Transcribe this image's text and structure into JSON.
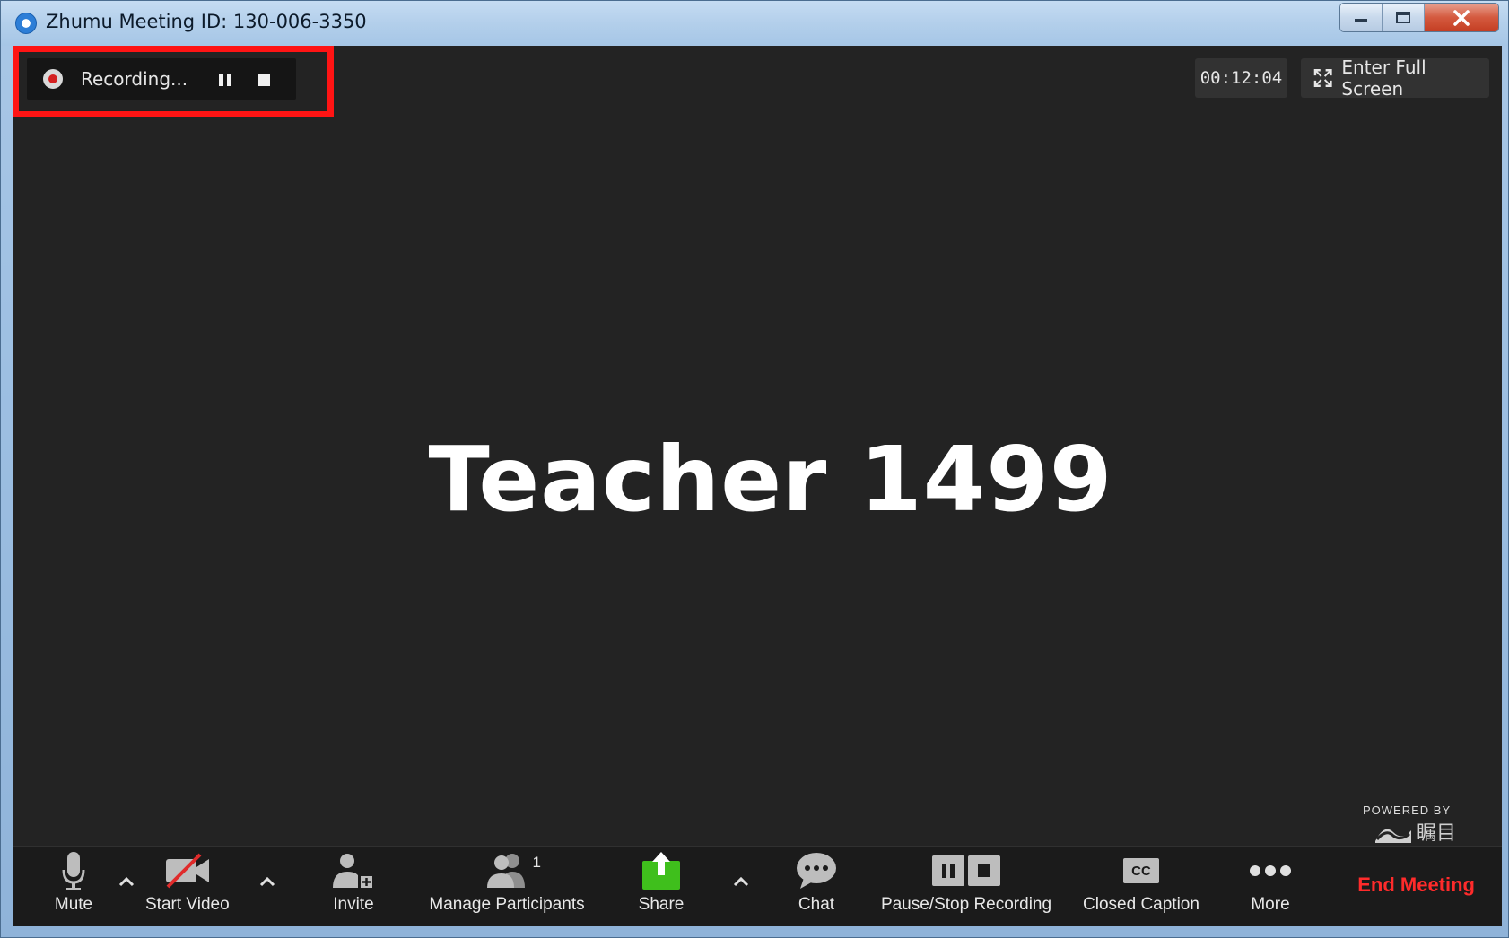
{
  "window": {
    "title": "Zhumu Meeting ID: 130-006-3350",
    "minimize_glyph": "—",
    "restore_glyph": "❐",
    "close_glyph": "✕"
  },
  "recording": {
    "label": "Recording...",
    "highlight_color": "#ff1414"
  },
  "header": {
    "timer": "00:12:04",
    "fullscreen_label": "Enter Full Screen"
  },
  "main": {
    "participant_name": "Teacher 1499"
  },
  "branding": {
    "powered_by": "POWERED BY",
    "logo_text": "瞩目"
  },
  "toolbar": {
    "mute_label": "Mute",
    "start_video_label": "Start Video",
    "invite_label": "Invite",
    "manage_participants_label": "Manage Participants",
    "participant_count": "1",
    "share_label": "Share",
    "chat_label": "Chat",
    "pause_stop_recording_label": "Pause/Stop Recording",
    "closed_caption_label": "Closed Caption",
    "cc_text": "CC",
    "more_label": "More",
    "end_meeting_label": "End Meeting",
    "share_color": "#3fbf1c",
    "end_color": "#ff2b2b"
  }
}
